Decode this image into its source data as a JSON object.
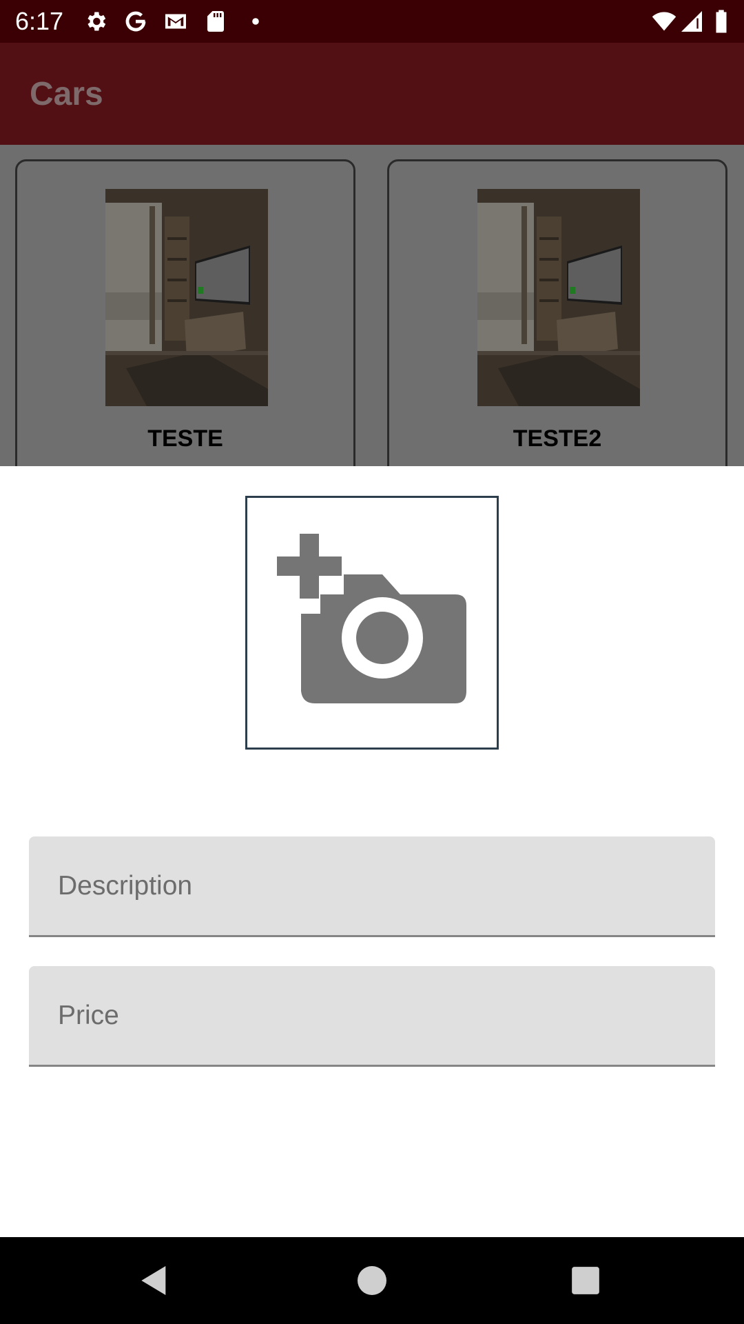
{
  "status_bar": {
    "time": "6:17",
    "icons": [
      "settings-icon",
      "google-icon",
      "gmail-icon",
      "sd-card-icon",
      "notification-dot-icon",
      "wifi-icon",
      "cell-signal-icon",
      "battery-icon"
    ]
  },
  "app_bar": {
    "title": "Cars"
  },
  "cars": [
    {
      "name": "TESTE",
      "image": "room-tv-photo"
    },
    {
      "name": "TESTE2",
      "image": "room-tv-photo"
    }
  ],
  "form": {
    "photo_icon": "add-a-photo-icon",
    "description": {
      "value": "",
      "placeholder": "Description"
    },
    "price": {
      "value": "",
      "placeholder": "Price"
    }
  },
  "nav_bar": {
    "icons": [
      "back-icon",
      "home-icon",
      "recents-icon"
    ]
  },
  "colors": {
    "status_bar": "#3a0004",
    "app_bar": "#521014",
    "scrim_area": "#6e6e6e",
    "field_background": "#e0e0e0",
    "icon_gray": "#757575"
  }
}
